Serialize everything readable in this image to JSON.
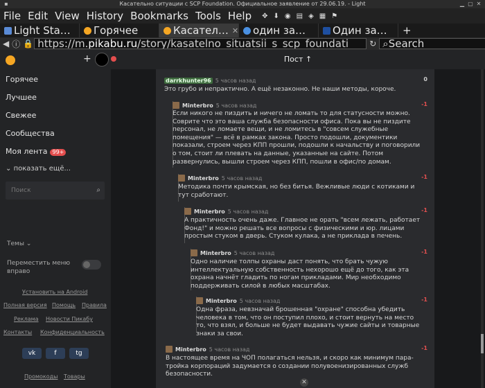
{
  "window": {
    "title": "Касательно ситуации с SCP Foundation. Официальное заявление от 29.06.19. - Light"
  },
  "menu": [
    "File",
    "Edit",
    "View",
    "History",
    "Bookmarks",
    "Tools",
    "Help"
  ],
  "tabs": [
    {
      "label": "Light Sta…",
      "color": "#5a8bd6"
    },
    {
      "label": "Горячее",
      "color": "#f5a623"
    },
    {
      "label": "Касател…",
      "color": "#f5a623"
    },
    {
      "label": "один за…",
      "color": "#4a90e2"
    },
    {
      "label": "Один за…",
      "color": "#1e4fa0"
    }
  ],
  "url": {
    "prefix": "https://m.",
    "domain": "pikabu.ru",
    "path": "/story/kasatelno_situatsii_s_scp_foundati"
  },
  "search_placeholder": "Search",
  "sidebar": {
    "items": [
      "Горячее",
      "Лучшее",
      "Свежее",
      "Сообщества"
    ],
    "feed": "Моя лента",
    "feed_badge": "99+",
    "more": "показать ещё...",
    "search_placeholder": "Поиск",
    "themes": "Темы",
    "move_menu": "Переместить меню вправо",
    "android": "Установить на Android",
    "links_row1": [
      "Полная версия",
      "Помощь",
      "Правила"
    ],
    "links_row2": [
      "Реклама",
      "Новости Пикабу"
    ],
    "links_row3": [
      "Контакты",
      "Конфиденциальность"
    ],
    "social": [
      "vk",
      "f",
      "tg"
    ],
    "links_row4": [
      "Промокоды",
      "Товары"
    ]
  },
  "topbar": {
    "title": "Пост ↑"
  },
  "comments": [
    {
      "user": "darrkhunter96",
      "time": "5 часов назад",
      "score": "0",
      "text": "Это грубо и непрактично. А ещё незаконно. Не наши методы, короче."
    },
    {
      "user": "Minterbro",
      "time": "5 часов назад",
      "score": "-1",
      "text": "Если никого не пиздить и ничего не ломать то для статусности можно. Соврите что это ваша служба безопасности офиса. Пока вы не пиздите персонал, не ломаете вещи, и не ломитесь в \"совсем служебные помещения\" — всё в рамках закона. Просто подошли, документики показали, строем через КПП прошли, подошли к начальству и поговорили о том, стоит ли плевать на данные, указанные на сайте. Потом развернулись, вышли строем через КПП, пошли в офис/по домам."
    },
    {
      "user": "Minterbro",
      "time": "5 часов назад",
      "score": "-1",
      "text": "Методика почти крымская, но без битья. Вежливые люди с котиками и тут сработают."
    },
    {
      "user": "Minterbro",
      "time": "5 часов назад",
      "score": "-1",
      "text": "А практичность очень даже. Главное не орать \"всем лежать, работает Фонд!\" и можно решать все вопросы с физическими и юр. лицами простым стуком в дверь. Стуком кулака, а не приклада в печень."
    },
    {
      "user": "Minterbro",
      "time": "5 часов назад",
      "score": "-1",
      "text": "Одно наличие толпы охраны даст понять, что брать чужую интеллектуальную собственность нехорошо ещё до того, как эта охрана начнёт гладить по ногам прикладами. Мир необходимо поддерживать силой в любых масштабах."
    },
    {
      "user": "Minterbro",
      "time": "5 часов назад",
      "score": "-1",
      "text": "Одна фраза, невзначай брошенная \"охране\" способна убедить человека в том, что он поступил плохо, и стоит вернуть на место то, что взял, и больше не будет выдавать чужие сайты и товарные знаки за свои."
    },
    {
      "user": "Minterbro",
      "time": "5 часов назад",
      "score": "-1",
      "text": "В настоящее время на ЧОП полагаться нельзя, и скоро как минимум пара-тройка корпораций задумается о создании полувоенизированных служб безопасности."
    }
  ]
}
